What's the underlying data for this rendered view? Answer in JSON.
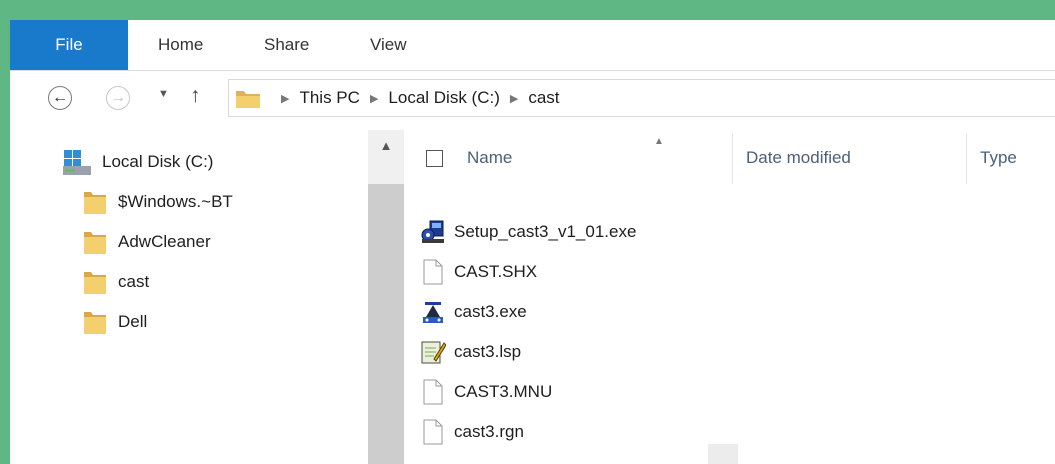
{
  "ribbon": {
    "tabs": [
      {
        "label": "File",
        "active": true
      },
      {
        "label": "Home"
      },
      {
        "label": "Share"
      },
      {
        "label": "View"
      }
    ],
    "accent": "#1979ca"
  },
  "nav": {
    "back_icon": "back-arrow-icon",
    "forward_icon": "forward-arrow-icon",
    "recent_icon": "dropdown-arrow-icon",
    "up_icon": "up-arrow-icon"
  },
  "address": {
    "crumbs": [
      "This PC",
      "Local Disk (C:)",
      "cast"
    ]
  },
  "navpane": {
    "items": [
      {
        "label": "Local Disk (C:)",
        "icon": "drive-icon"
      },
      {
        "label": "$Windows.~BT",
        "icon": "folder-icon"
      },
      {
        "label": "AdwCleaner",
        "icon": "folder-icon"
      },
      {
        "label": "cast",
        "icon": "folder-icon"
      },
      {
        "label": "Dell",
        "icon": "folder-icon"
      }
    ]
  },
  "content": {
    "columns": [
      "Name",
      "Date modified",
      "Type"
    ],
    "files": [
      {
        "name": "Setup_cast3_v1_01.exe",
        "icon": "setup-exe-icon"
      },
      {
        "name": "CAST.SHX",
        "icon": "blank-file-icon"
      },
      {
        "name": "cast3.exe",
        "icon": "app-exe-icon"
      },
      {
        "name": "cast3.lsp",
        "icon": "notepad-file-icon"
      },
      {
        "name": "CAST3.MNU",
        "icon": "blank-file-icon"
      },
      {
        "name": "cast3.rgn",
        "icon": "blank-file-icon"
      }
    ]
  }
}
